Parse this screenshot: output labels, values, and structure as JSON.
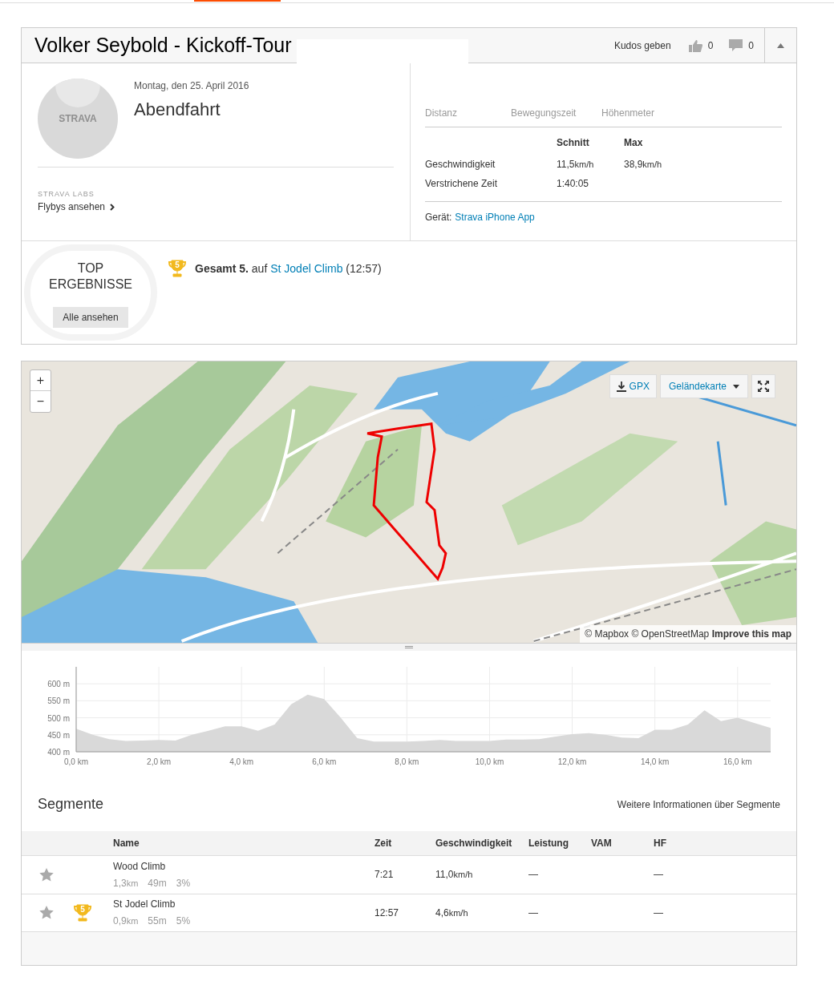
{
  "activity": {
    "title": "Volker Seybold - Kickoff-Tour",
    "kudos_label": "Kudos geben",
    "kudos_count": "0",
    "comment_count": "0",
    "date": "Montag, den 25. April 2016",
    "name": "Abendfahrt",
    "avatar_text": "STRAVA"
  },
  "labs": {
    "label": "STRAVA LABS",
    "link": "Flybys ansehen"
  },
  "stats": {
    "headline_labels": [
      "Distanz",
      "Bewegungszeit",
      "Höhenmeter"
    ],
    "columns": [
      "Schnitt",
      "Max"
    ],
    "rows": [
      {
        "label": "Geschwindigkeit",
        "avg": "11,5",
        "avg_unit": "km/h",
        "max": "38,9",
        "max_unit": "km/h"
      },
      {
        "label": "Verstrichene Zeit",
        "avg": "1:40:05"
      }
    ],
    "device_label": "Gerät:",
    "device": "Strava iPhone App"
  },
  "top_results": {
    "title_lines": [
      "TOP",
      "ERGEBNISSE"
    ],
    "button": "Alle ansehen",
    "achievements": [
      {
        "rank": "5",
        "text": "**Gesamt 5.** auf",
        "link": "St Jodel Climb",
        "time": "(12:57)"
      }
    ]
  },
  "map": {
    "zoom_in": "+",
    "zoom_out": "−",
    "gpx": "GPX",
    "map_type": "Geländekarte",
    "attribution": "© Mapbox © OpenStreetMap",
    "attribution_link": "Improve this map"
  },
  "elevation": {
    "chart_data": {
      "type": "area",
      "x": [
        0,
        0.4,
        0.8,
        1.2,
        1.6,
        2.0,
        2.4,
        2.8,
        3.2,
        3.6,
        4.0,
        4.4,
        4.8,
        5.2,
        5.6,
        6.0,
        6.4,
        6.8,
        7.2,
        7.6,
        8.0,
        8.4,
        8.8,
        9.2,
        9.6,
        10.0,
        10.4,
        10.8,
        11.2,
        11.6,
        12.0,
        12.4,
        12.8,
        13.2,
        13.6,
        14.0,
        14.4,
        14.8,
        15.2,
        15.6,
        16.0,
        16.4,
        16.8
      ],
      "grid": true,
      "series": [
        {
          "color": "#d9d9d9",
          "values": [
            468,
            450,
            437,
            432,
            433,
            435,
            433,
            450,
            462,
            475,
            475,
            462,
            480,
            540,
            568,
            555,
            500,
            440,
            430,
            430,
            430,
            432,
            435,
            432,
            432,
            432,
            436,
            436,
            437,
            445,
            452,
            455,
            450,
            442,
            440,
            465,
            465,
            480,
            522,
            490,
            500,
            485,
            470
          ]
        }
      ],
      "xlim": [
        0,
        16.8
      ],
      "ylim": [
        400,
        650
      ],
      "xticks": [
        {
          "value": 0,
          "label": "0,0 km"
        },
        {
          "value": 2,
          "label": "2,0 km"
        },
        {
          "value": 4,
          "label": "4,0 km"
        },
        {
          "value": 6,
          "label": "6,0 km"
        },
        {
          "value": 8,
          "label": "8,0 km"
        },
        {
          "value": 10,
          "label": "10,0 km"
        },
        {
          "value": 12,
          "label": "12,0 km"
        },
        {
          "value": 14,
          "label": "14,0 km"
        },
        {
          "value": 16,
          "label": "16,0 km"
        }
      ],
      "yticks": [
        {
          "value": 400,
          "label": "400 m"
        },
        {
          "value": 450,
          "label": "450 m"
        },
        {
          "value": 500,
          "label": "500 m"
        },
        {
          "value": 550,
          "label": "550 m"
        },
        {
          "value": 600,
          "label": "600 m"
        }
      ]
    }
  },
  "segments": {
    "title": "Segmente",
    "info_link": "Weitere Informationen über Segmente",
    "columns": [
      "Name",
      "Zeit",
      "Geschwindigkeit",
      "Leistung",
      "VAM",
      "HF"
    ],
    "rows": [
      {
        "starred": false,
        "name": "Wood Climb",
        "distance": "1,3",
        "distance_unit": "km",
        "elevation": "49m",
        "grade": "3%",
        "time": "7:21",
        "speed": "11,0",
        "speed_unit": "km/h",
        "power": "—",
        "hr": "—"
      },
      {
        "starred": false,
        "rank": "5",
        "name": "St Jodel Climb",
        "distance": "0,9",
        "distance_unit": "km",
        "elevation": "55m",
        "grade": "5%",
        "time": "12:57",
        "speed": "4,6",
        "speed_unit": "km/h",
        "power": "—",
        "hr": "—"
      }
    ]
  }
}
